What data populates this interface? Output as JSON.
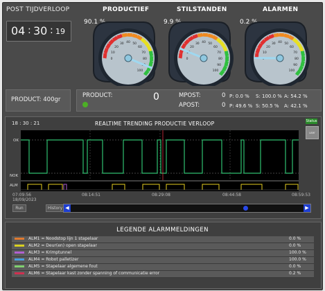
{
  "post": {
    "title": "POST TIJDVERLOOP",
    "clock_hours": "04",
    "clock_minutes": "30",
    "clock_seconds": "19"
  },
  "gauges": [
    {
      "title": "PRODUCTIEF",
      "pct_label": "90.1 %",
      "value": 90.1
    },
    {
      "title": "STILSTANDEN",
      "pct_label": "9.9 %",
      "value": 9.9
    },
    {
      "title": "ALARMEN",
      "pct_label": "0.2 %",
      "value": 0.2
    }
  ],
  "gauge_scale": [
    "0",
    "10",
    "20",
    "30",
    "40",
    "50",
    "60",
    "70",
    "80",
    "90",
    "100"
  ],
  "product_label": "PRODUCT: 400gr",
  "stats": {
    "product_label": "PRODUCT:",
    "product_value": "0",
    "status_color": "#4caf25",
    "mpost_label": "MPOST:",
    "mpost_value": "0",
    "mpost_p": "P: 0.0 %",
    "mpost_s": "S: 100.0 %",
    "mpost_a": "A: 54.2 %",
    "apost_label": "APOST:",
    "apost_value": "0",
    "apost_p": "P: 49.6 %",
    "apost_s": "S: 50.5 %",
    "apost_a": "A: 42.1 %"
  },
  "trend": {
    "time": "18 : 30 : 21",
    "title": "REALTIME TRENDING PRODUCTIE VERLOOP",
    "status_btn": "Status",
    "side_btn": "user",
    "ok_label": "OK",
    "nok_label": "NOK",
    "alm_label": "ALM",
    "times": [
      "07:09:56",
      "08:14:51",
      "08:29:08",
      "08:44:58",
      "08:59:53"
    ],
    "date": "18/09/2023",
    "run_btn": "Run",
    "history_btn": "History",
    "scroll_position": 0.76
  },
  "legend": {
    "title": "LEGENDE ALARMMELDINGEN",
    "rows": [
      {
        "name": "ALM1 = Noodstop lijn 1 stapelaar",
        "pct": "0.0 %",
        "color": "#e07a30"
      },
      {
        "name": "ALM2 = Deur(en) open stapelaar",
        "pct": "0.0 %",
        "color": "#d8d020"
      },
      {
        "name": "ALM3 = Krimptunnel",
        "pct": "100.0 %",
        "color": "#b060d0"
      },
      {
        "name": "ALM4 = Robot palletizer",
        "pct": "100.0 %",
        "color": "#4aa0e0"
      },
      {
        "name": "ALM5 = Stapelaar algemene fout",
        "pct": "0.0 %",
        "color": "#80d070"
      },
      {
        "name": "ALM6 = Stapelaar kast zonder spanning of communicatie error",
        "pct": "0.2 %",
        "color": "#d03050"
      }
    ]
  },
  "colors": {
    "ok_line": "#30c070",
    "alarm_yellow": "#e8d020",
    "alarm_purple": "#b060d0",
    "alarm_red": "#e03040"
  }
}
